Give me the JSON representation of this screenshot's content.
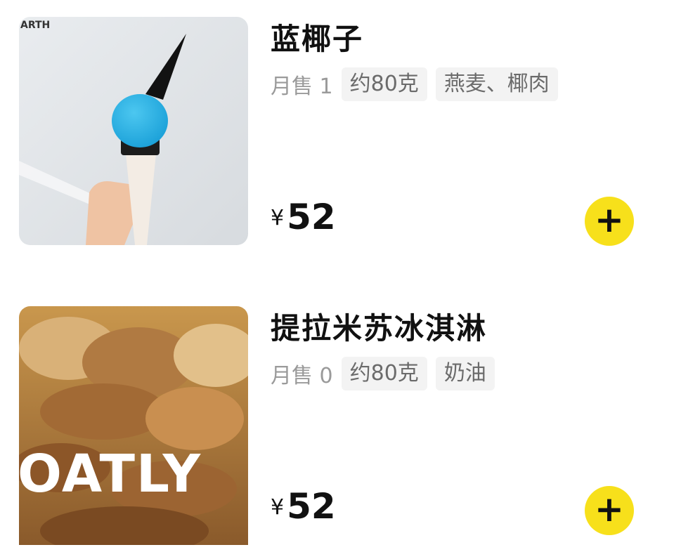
{
  "products": [
    {
      "name": "蓝椰子",
      "sales": "月售 1",
      "tags": [
        "约80克",
        "燕麦、椰肉"
      ],
      "currency": "¥",
      "price": "52",
      "image_text": "ARTH",
      "image_icon": "ice-cream-cone-photo",
      "add_icon": "plus-icon"
    },
    {
      "name": "提拉米苏冰淇淋",
      "sales": "月售 0",
      "tags": [
        "约80克",
        "奶油"
      ],
      "currency": "¥",
      "price": "52",
      "image_text": "OATLY",
      "image_icon": "tiramisu-photo",
      "add_icon": "plus-icon"
    }
  ],
  "colors": {
    "accent_button": "#f7e01b",
    "tag_bg": "#f3f3f3",
    "muted_text": "#9a9a9a"
  }
}
